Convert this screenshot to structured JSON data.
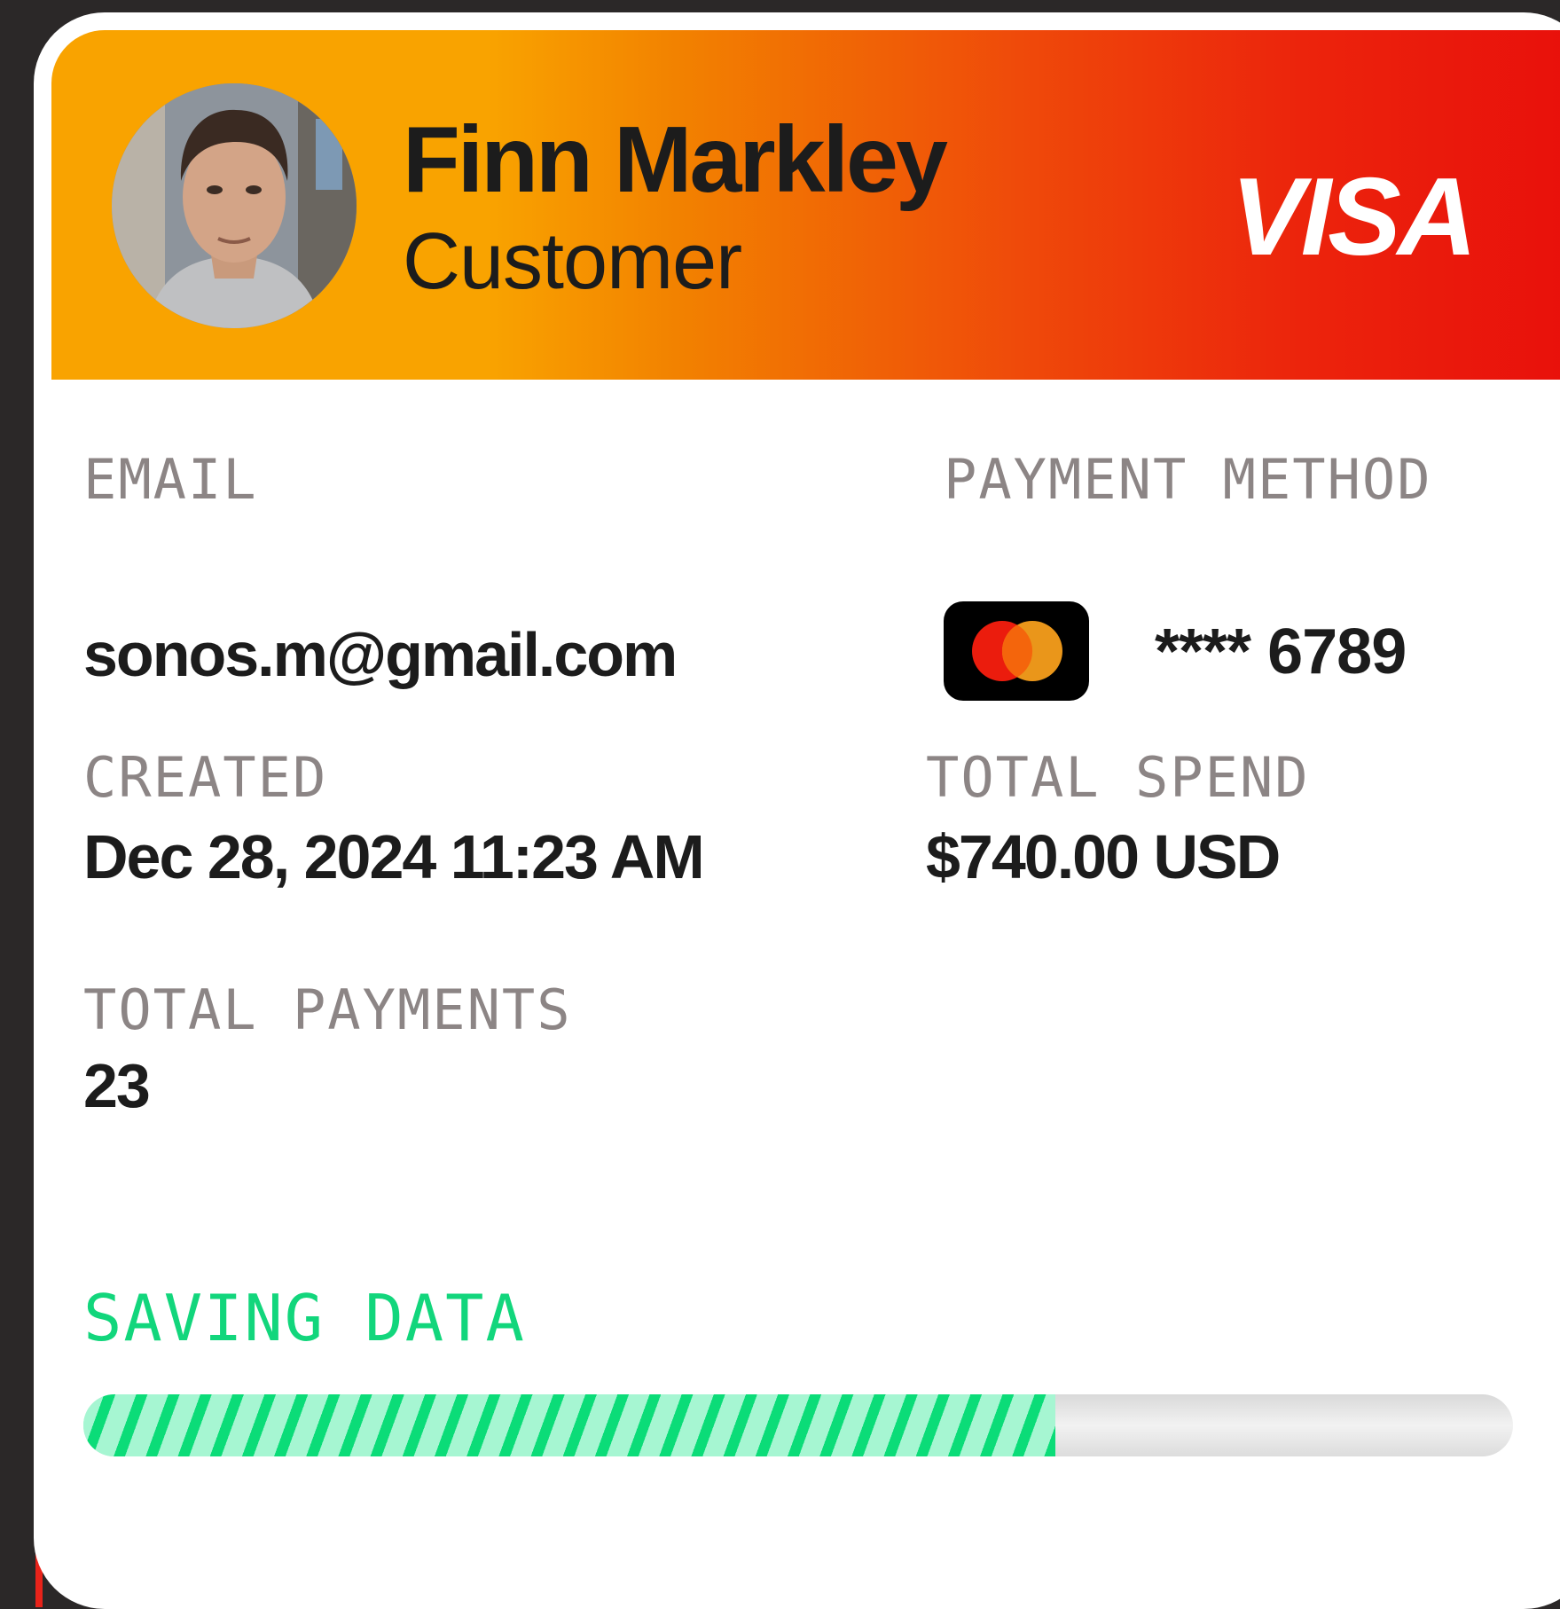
{
  "customer": {
    "name": "Finn Markley",
    "role": "Customer"
  },
  "card_brand": "VISA",
  "fields": {
    "email": {
      "label": "EMAIL",
      "value": "sonos.m@gmail.com"
    },
    "payment_method": {
      "label": "PAYMENT METHOD",
      "icon": "mastercard-icon",
      "masked_number": "**** 6789"
    },
    "created": {
      "label": "CREATED",
      "value": "Dec 28, 2024 11:23 AM"
    },
    "total_spend": {
      "label": "TOTAL SPEND",
      "value": "$740.00 USD"
    },
    "total_payments": {
      "label": "TOTAL PAYMENTS",
      "value": "23"
    }
  },
  "saving": {
    "label": "SAVING DATA",
    "progress": 0.68
  },
  "colors": {
    "header_start": "#f9a300",
    "header_end": "#e80d0b",
    "saving_green": "#12d67c",
    "progress_fill": "#a6f6d2",
    "progress_stripe": "#0bdc78",
    "mastercard_red": "#eb1c0d",
    "mastercard_orange": "#f79e1b"
  }
}
